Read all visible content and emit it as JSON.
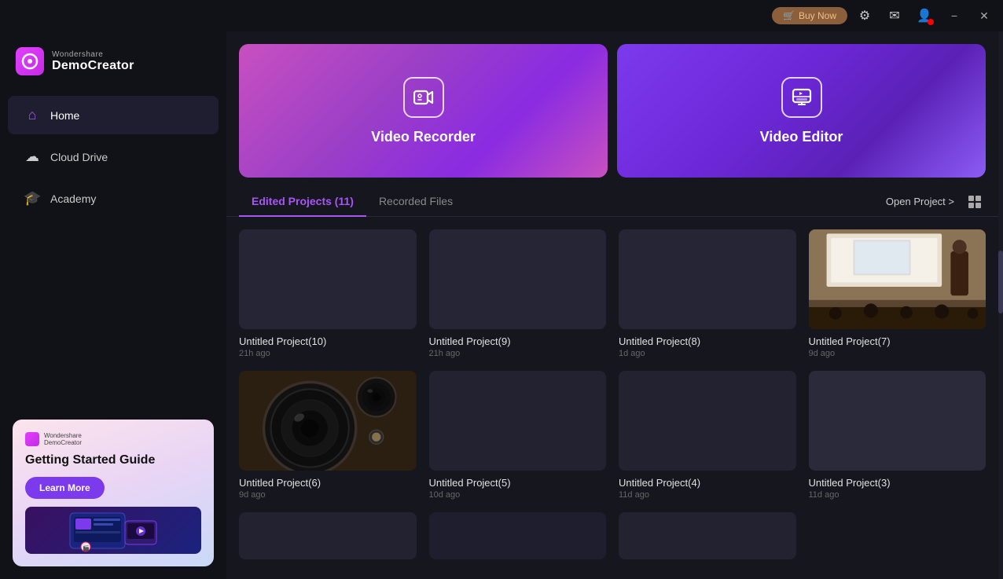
{
  "titlebar": {
    "buy_now": "Buy Now",
    "cart_icon": "🛒",
    "settings_icon": "⚙",
    "mail_icon": "✉",
    "user_icon": "👤",
    "minimize": "−",
    "close": "✕"
  },
  "logo": {
    "top": "Wondershare",
    "main": "DemoCreator"
  },
  "nav": {
    "home": "Home",
    "cloud_drive": "Cloud Drive",
    "academy": "Academy"
  },
  "getting_started": {
    "brand_top": "Wondershare",
    "brand_bottom": "DemoCreator",
    "title": "Getting Started Guide",
    "button": "Learn More"
  },
  "hero": {
    "recorder_label": "Video Recorder",
    "editor_label": "Video Editor"
  },
  "tabs": {
    "edited": "Edited Projects (11)",
    "recorded": "Recorded Files",
    "open_project": "Open Project >",
    "grid_icon": "⊞"
  },
  "projects": [
    {
      "id": 1,
      "name": "Untitled Project(10)",
      "time": "21h ago",
      "has_thumb": false,
      "thumb_type": "empty"
    },
    {
      "id": 2,
      "name": "Untitled Project(9)",
      "time": "21h ago",
      "has_thumb": false,
      "thumb_type": "empty"
    },
    {
      "id": 3,
      "name": "Untitled Project(8)",
      "time": "1d ago",
      "has_thumb": false,
      "thumb_type": "empty"
    },
    {
      "id": 4,
      "name": "Untitled Project(7)",
      "time": "9d ago",
      "has_thumb": true,
      "thumb_type": "classroom"
    },
    {
      "id": 5,
      "name": "Untitled Project(6)",
      "time": "9d ago",
      "has_thumb": true,
      "thumb_type": "camera"
    },
    {
      "id": 6,
      "name": "Untitled Project(5)",
      "time": "10d ago",
      "has_thumb": false,
      "thumb_type": "dark"
    },
    {
      "id": 7,
      "name": "Untitled Project(4)",
      "time": "11d ago",
      "has_thumb": false,
      "thumb_type": "dark"
    },
    {
      "id": 8,
      "name": "Untitled Project(3)",
      "time": "11d ago",
      "has_thumb": false,
      "thumb_type": "dark_light"
    }
  ]
}
